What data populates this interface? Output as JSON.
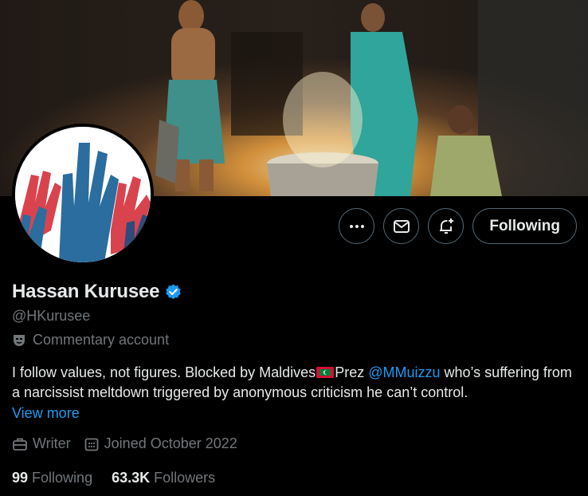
{
  "banner": {
    "description_icon": "banner-image"
  },
  "profile": {
    "display_name": "Hassan Kurusee",
    "handle": "@HKurusee",
    "verified_icon": "verified-badge-icon",
    "account_label": "Commentary account",
    "bio_part1": "I follow values, not figures. Blocked by Maldives",
    "bio_part2": "Prez ",
    "bio_mention": "@MMuizzu",
    "bio_part3": " who’s suffering from a narcissist meltdown triggered by anonymous criticism he can’t control.",
    "view_more": "View more",
    "profession": "Writer",
    "joined": "Joined October 2022"
  },
  "actions": {
    "more_icon": "more-icon",
    "message_icon": "message-icon",
    "notify_icon": "notification-add-icon",
    "follow_label": "Following"
  },
  "stats": {
    "following_count": "99",
    "following_label": "Following",
    "followers_count": "63.3K",
    "followers_label": "Followers"
  },
  "colors": {
    "accent": "#1d9bf0",
    "secondary_text": "#71767b",
    "primary_text": "#e7e9ea",
    "background": "#000000"
  }
}
